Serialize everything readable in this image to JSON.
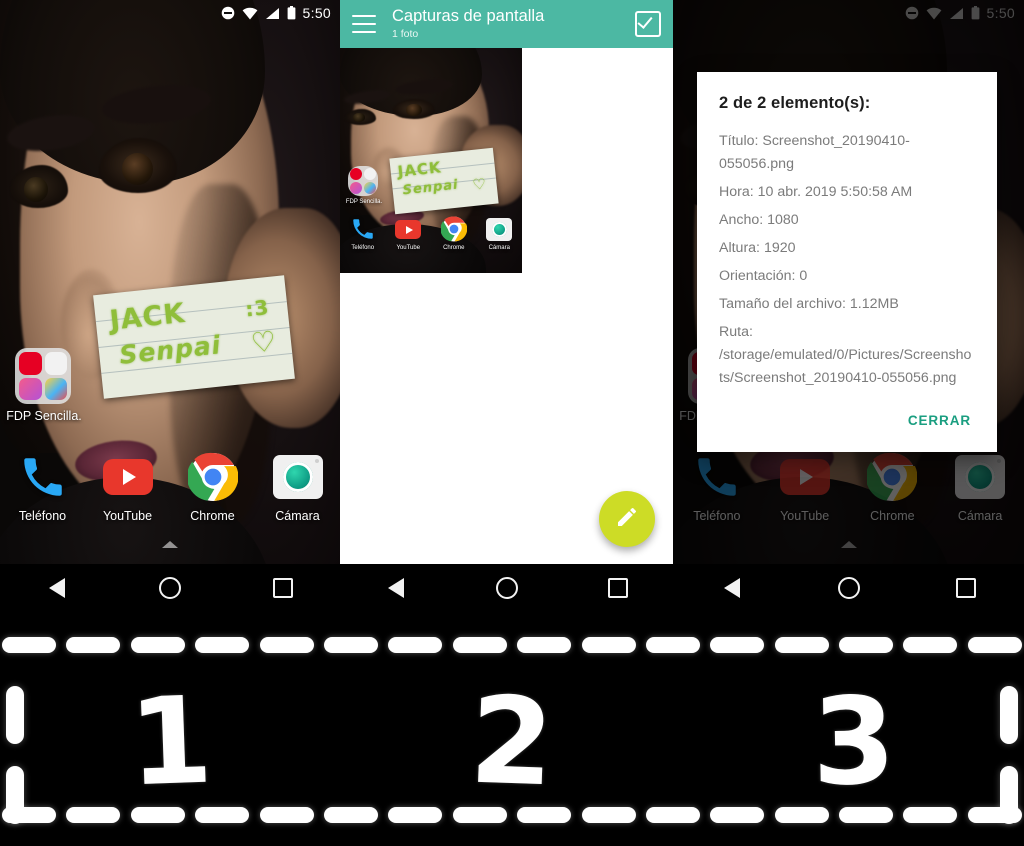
{
  "statusbar": {
    "time": "5:50",
    "icons": [
      "do-not-disturb-icon",
      "wifi-icon",
      "signal-icon",
      "battery-icon"
    ]
  },
  "homescreen": {
    "folder": {
      "label": "FDP Sencilla."
    },
    "dock": [
      {
        "label": "Teléfono",
        "icon": "phone-icon"
      },
      {
        "label": "YouTube",
        "icon": "youtube-icon"
      },
      {
        "label": "Chrome",
        "icon": "chrome-icon"
      },
      {
        "label": "Cámara",
        "icon": "camera-icon"
      }
    ],
    "note_text_line1": "JACK",
    "note_text_line2": "Senpai"
  },
  "navbar": {
    "back": "back-button",
    "home": "home-button",
    "recents": "recents-button"
  },
  "gallery": {
    "menu_icon": "hamburger-menu-icon",
    "title": "Capturas de pantalla",
    "subtitle": "1 foto",
    "select_icon": "checkbox-checked-icon",
    "fab_icon": "pencil-edit-icon",
    "accent_color": "#4cb8a3",
    "fab_color": "#cddc26"
  },
  "dialog": {
    "title": "2 de 2 elemento(s):",
    "lines": [
      "Título: Screenshot_20190410-055056.png",
      "Hora: 10 abr. 2019 5:50:58 AM",
      "Ancho: 1080",
      "Altura: 1920",
      "Orientación: 0",
      "Tamaño del archivo: 1.12MB",
      "Ruta: /storage/emulated/0/Pictures/Screenshots/Screenshot_20190410-055056.png"
    ],
    "fields": {
      "titulo_label": "Título:",
      "titulo_value": "Screenshot_20190410-055056.png",
      "hora_label": "Hora:",
      "hora_value": "10 abr. 2019 5:50:58 AM",
      "ancho_label": "Ancho:",
      "ancho_value": "1080",
      "altura_label": "Altura:",
      "altura_value": "1920",
      "orientacion_label": "Orientación:",
      "orientacion_value": "0",
      "tamano_label": "Tamaño del archivo:",
      "tamano_value": "1.12MB",
      "ruta_label": "Ruta:",
      "ruta_value": "/storage/emulated/0/Pictures/Screenshots/Screenshot_20190410-055056.png"
    },
    "close_button": "CERRAR",
    "close_color": "#1a9e80"
  },
  "filmstrip": {
    "numbers": [
      "1",
      "2",
      "3"
    ]
  }
}
